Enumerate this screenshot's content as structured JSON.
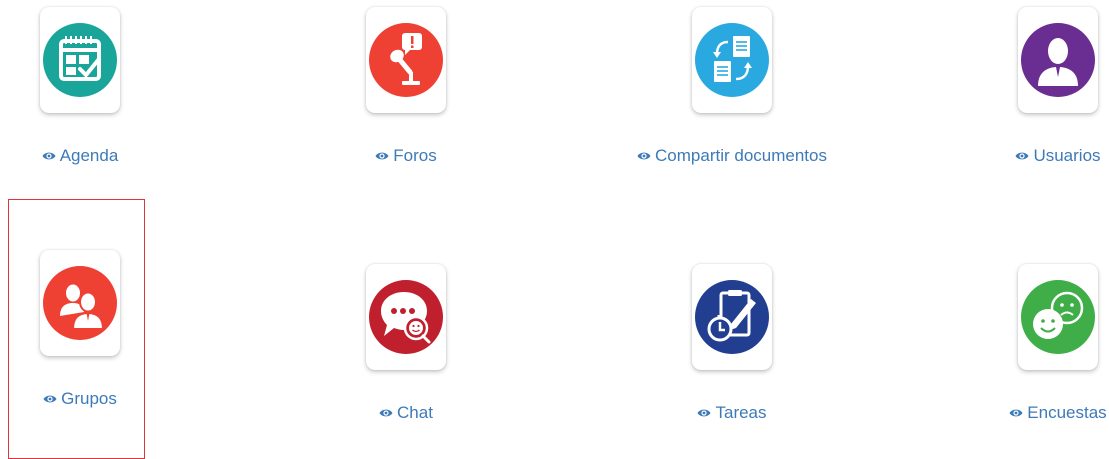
{
  "tools": [
    {
      "id": "agenda",
      "label": "Agenda",
      "icon": "calendar-icon",
      "color": "#1aa59a"
    },
    {
      "id": "foros",
      "label": "Foros",
      "icon": "microphone-icon",
      "color": "#ef4034"
    },
    {
      "id": "compartir",
      "label": "Compartir documentos",
      "icon": "document-exchange-icon",
      "color": "#2aa9e0"
    },
    {
      "id": "usuarios",
      "label": "Usuarios",
      "icon": "user-icon",
      "color": "#6a2d91"
    },
    {
      "id": "grupos",
      "label": "Grupos",
      "icon": "group-icon",
      "color": "#ef4034"
    },
    {
      "id": "chat",
      "label": "Chat",
      "icon": "chat-bubble-icon",
      "color": "#c01f2e"
    },
    {
      "id": "tareas",
      "label": "Tareas",
      "icon": "task-clipboard-icon",
      "color": "#223e91"
    },
    {
      "id": "encuestas",
      "label": "Encuestas",
      "icon": "smiley-faces-icon",
      "color": "#3fae49"
    }
  ],
  "link_color": "#3d7ab8",
  "selected_tool": "grupos",
  "selection_color": "#d9363e"
}
